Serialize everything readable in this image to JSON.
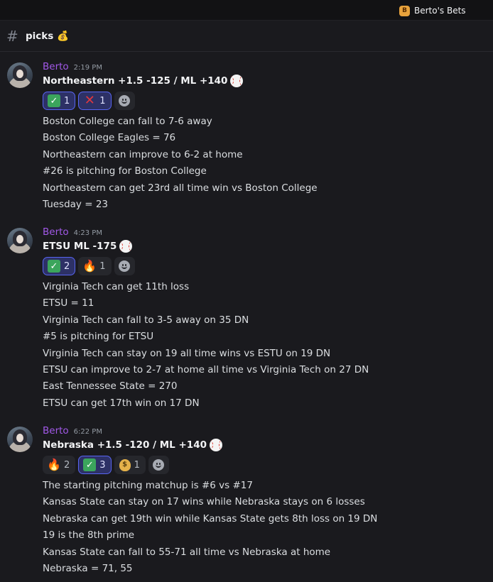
{
  "topbar": {
    "server_name": "Berto's Bets"
  },
  "channel": {
    "name": "picks",
    "emoji": "💰"
  },
  "messages": [
    {
      "author": "Berto",
      "time": "2:19 PM",
      "title": "Northeastern +1.5 -125 / ML +140",
      "reactions": [
        {
          "emoji": "check",
          "glyph": "✓",
          "count": "1",
          "active": true
        },
        {
          "emoji": "cross",
          "glyph": "✕",
          "count": "1",
          "active": true
        }
      ],
      "lines": [
        "Boston College can fall to 7-6 away",
        "Boston College Eagles = 76",
        "Northeastern can improve to 6-2 at home",
        "#26 is pitching for Boston College",
        "Northeastern can get 23rd all time win vs Boston College",
        "Tuesday = 23"
      ]
    },
    {
      "author": "Berto",
      "time": "4:23 PM",
      "title": "ETSU ML -175",
      "reactions": [
        {
          "emoji": "check",
          "glyph": "✓",
          "count": "2",
          "active": true
        },
        {
          "emoji": "fire",
          "glyph": "🔥",
          "count": "1",
          "active": false
        }
      ],
      "lines": [
        "Virginia Tech can get 11th loss",
        "ETSU = 11",
        "Virginia Tech can fall to 3-5 away on 35 DN",
        "#5 is pitching for ETSU",
        "Virginia Tech can stay on 19 all time wins vs ESTU on 19 DN",
        "ETSU can improve to 2-7 at home all time vs Virginia Tech on 27 DN",
        "East Tennessee State = 270",
        "ETSU can get 17th win on 17 DN"
      ]
    },
    {
      "author": "Berto",
      "time": "6:22 PM",
      "title": "Nebraska +1.5 -120 / ML +140",
      "reactions": [
        {
          "emoji": "fire",
          "glyph": "🔥",
          "count": "2",
          "active": false
        },
        {
          "emoji": "check",
          "glyph": "✓",
          "count": "3",
          "active": true
        },
        {
          "emoji": "moneybag",
          "glyph": "$",
          "count": "1",
          "active": false
        }
      ],
      "lines": [
        "The starting pitching matchup is #6 vs #17",
        "Kansas State can stay on 17 wins while Nebraska stays on 6 losses",
        "Nebraska can get 19th win while Kansas State gets 8th loss on 19 DN",
        "19 is the 8th prime",
        "Kansas State can fall to 55-71 all time vs Nebraska at home",
        "Nebraska = 71, 55"
      ]
    }
  ],
  "colors": {
    "background": "#1a1a1e",
    "author": "#a259e8",
    "reaction_active_border": "#5865f2"
  }
}
